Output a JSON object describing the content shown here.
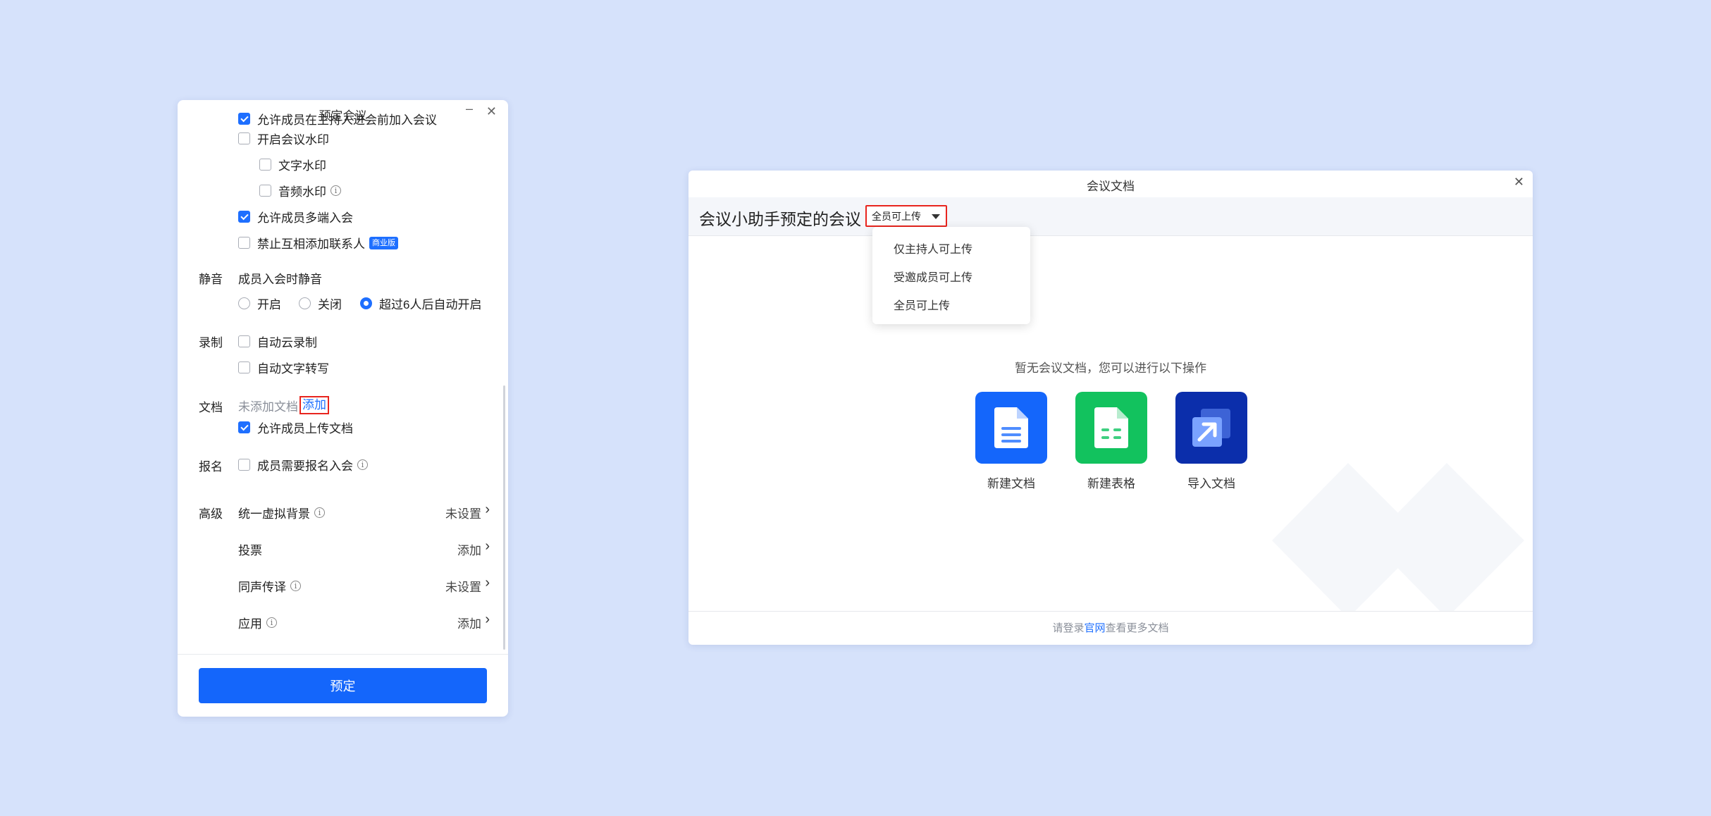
{
  "left_window": {
    "title": "预定会议",
    "top_cut_text": "允许成员在主持人进会前加入会议",
    "watermark": {
      "label": "开启会议水印",
      "checked": false
    },
    "text_watermark": {
      "label": "文字水印",
      "checked": false
    },
    "audio_watermark": {
      "label": "音频水印",
      "checked": false
    },
    "multi_device": {
      "label": "允许成员多端入会",
      "checked": true
    },
    "no_add_contacts": {
      "label": "禁止互相添加联系人",
      "checked": false,
      "badge": "商业版"
    },
    "mute": {
      "section": "静音",
      "title": "成员入会时静音",
      "options": [
        "开启",
        "关闭",
        "超过6人后自动开启"
      ],
      "selected": "超过6人后自动开启"
    },
    "record": {
      "section": "录制",
      "auto_cloud": {
        "label": "自动云录制",
        "checked": false
      },
      "auto_transcribe": {
        "label": "自动文字转写",
        "checked": false
      }
    },
    "docs": {
      "section": "文档",
      "status": "未添加文档",
      "add_link": "添加",
      "allow_upload": {
        "label": "允许成员上传文档",
        "checked": true
      }
    },
    "signup": {
      "section": "报名",
      "require": {
        "label": "成员需要报名入会",
        "checked": false
      }
    },
    "advanced": {
      "section": "高级",
      "items": [
        {
          "label": "统一虚拟背景",
          "value": "未设置",
          "has_info": true
        },
        {
          "label": "投票",
          "value": "添加",
          "has_info": false
        },
        {
          "label": "同声传译",
          "value": "未设置",
          "has_info": true
        },
        {
          "label": "应用",
          "value": "添加",
          "has_info": true
        }
      ]
    },
    "submit_label": "预定"
  },
  "right_window": {
    "title": "会议文档",
    "meeting_name": "会议小助手预定的会议",
    "permission": {
      "selected": "全员可上传",
      "options": [
        "仅主持人可上传",
        "受邀成员可上传",
        "全员可上传"
      ]
    },
    "empty_tip": "暂无会议文档，您可以进行以下操作",
    "actions": [
      {
        "label": "新建文档",
        "icon": "doc-icon",
        "color": "#1466fb"
      },
      {
        "label": "新建表格",
        "icon": "sheet-icon",
        "color": "#12c25e"
      },
      {
        "label": "导入文档",
        "icon": "import-icon",
        "color": "#0b2eab"
      }
    ],
    "footer": {
      "prefix": "请登录",
      "link": "官网",
      "suffix": "查看更多文档"
    }
  }
}
